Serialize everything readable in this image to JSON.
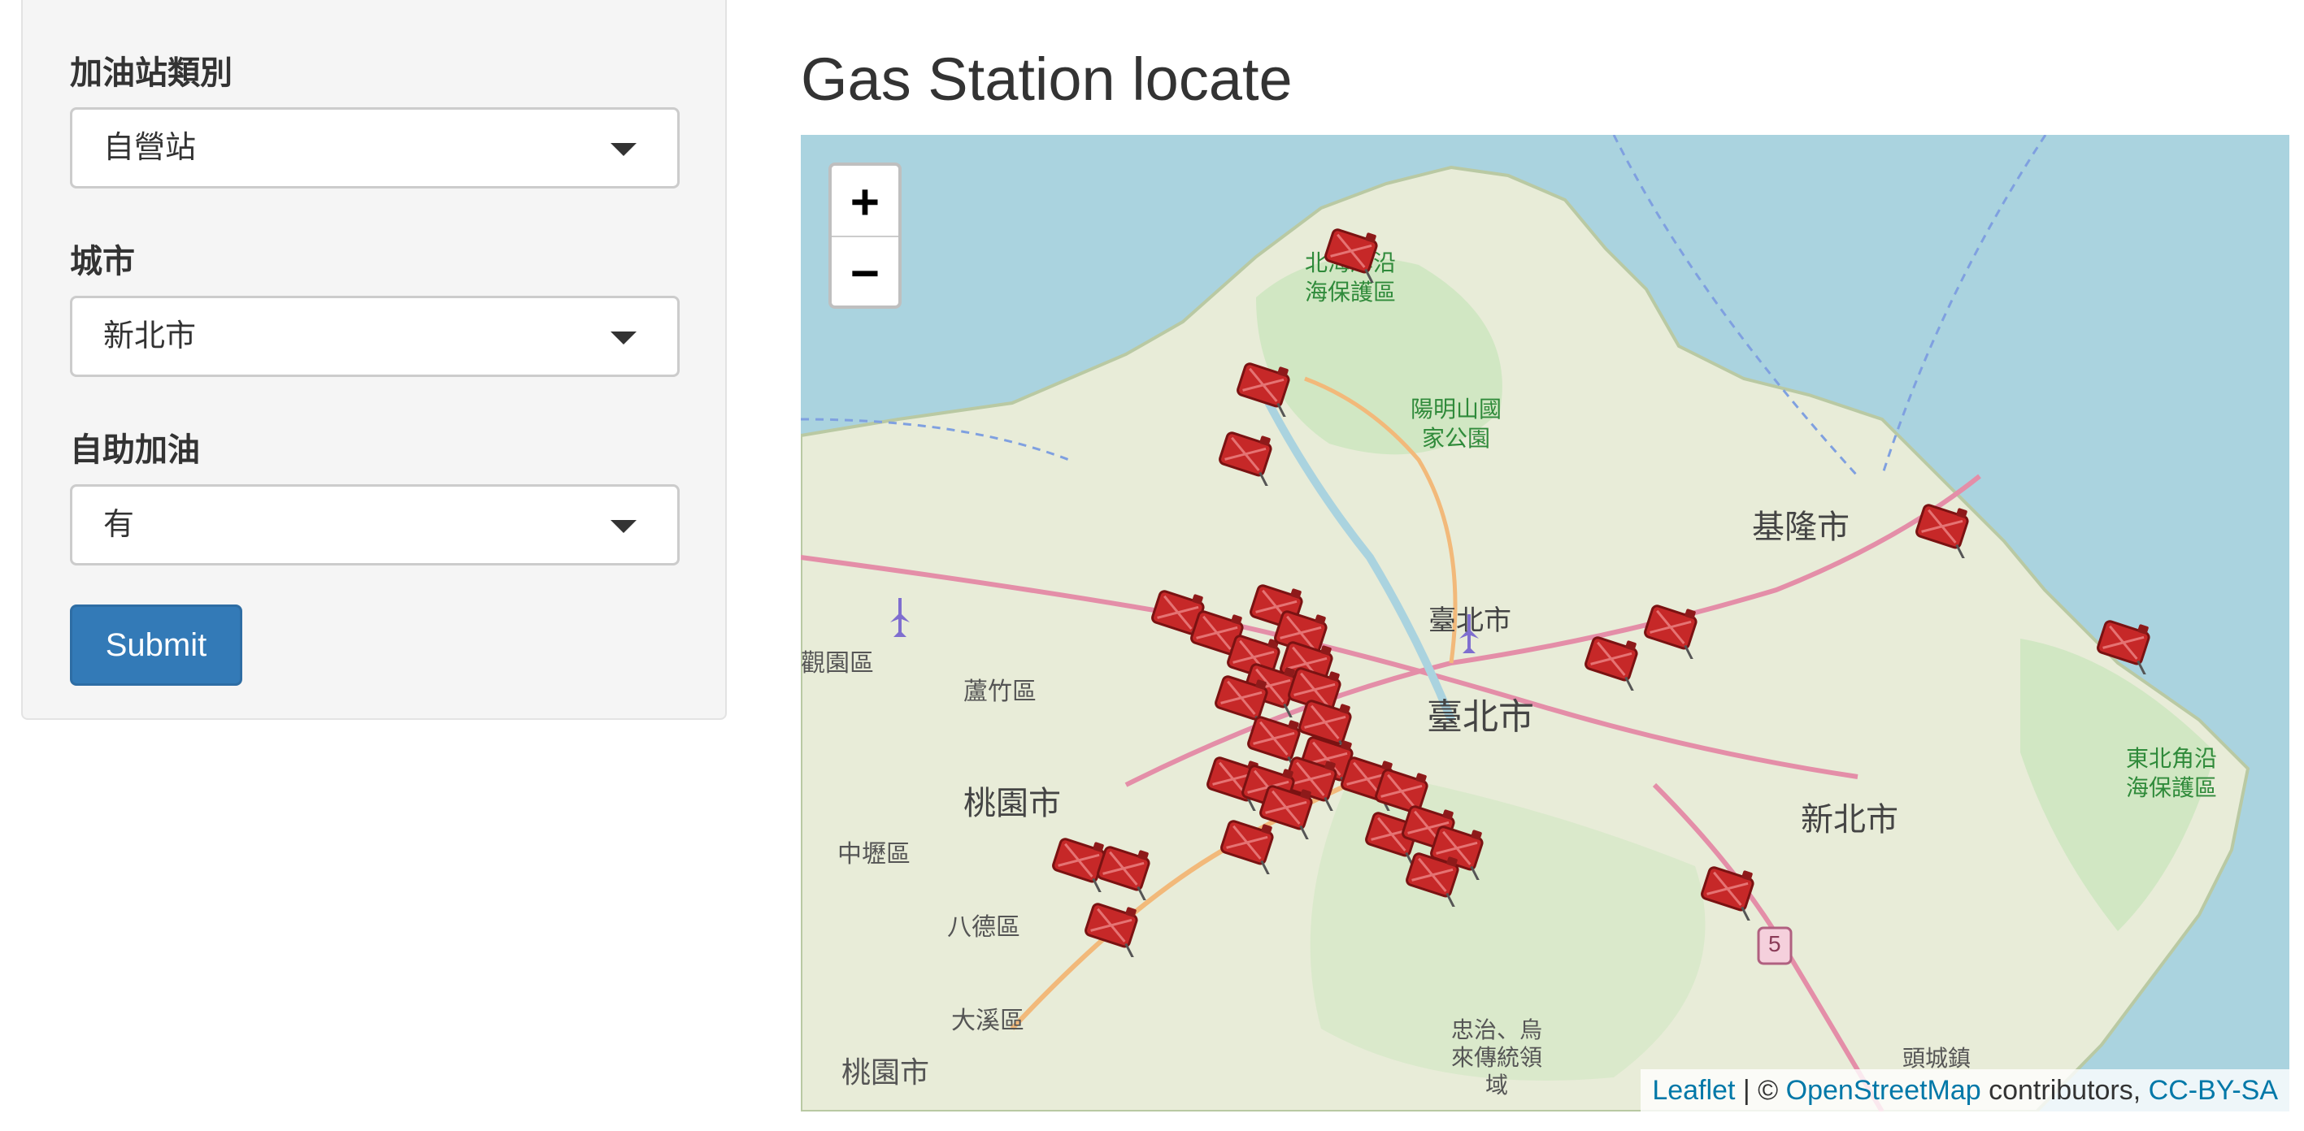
{
  "sidebar": {
    "category": {
      "label": "加油站類別",
      "value": "自營站"
    },
    "city": {
      "label": "城市",
      "value": "新北市"
    },
    "self_service": {
      "label": "自助加油",
      "value": "有"
    },
    "submit_label": "Submit"
  },
  "main": {
    "title": "Gas Station locate"
  },
  "map": {
    "zoom_in": "+",
    "zoom_out": "−",
    "attribution": {
      "leaflet": "Leaflet",
      "separator": " | © ",
      "osm": "OpenStreetMap",
      "contributors": " contributors, ",
      "license": "CC-BY-SA"
    },
    "places": {
      "taipei_city": "臺北市",
      "taipei_city_north": "臺北市",
      "keelung": "基隆市",
      "new_taipei": "新北市",
      "taoyuan": "桃園市",
      "taoyuan_south": "桃園市",
      "luzhu": "蘆竹區",
      "zhongli": "中壢區",
      "bade": "八德區",
      "daxi": "大溪區",
      "toucheng": "頭城鎮",
      "guanyin": "觀園區",
      "yangming": "陽明山國\n家公園",
      "northeast_coast": "東北角沿\n海保護區",
      "north_coast": "北海岸沿\n海保護區",
      "route_5": "5",
      "sanxia": "忠治、烏\n來傳統領\n域"
    },
    "marker_icon": "gas-can-icon",
    "colors": {
      "water": "#aad3df",
      "land": "#e8ecd8",
      "park": "#cde6c0",
      "marker": "#c62828"
    },
    "marker_count": 34
  }
}
